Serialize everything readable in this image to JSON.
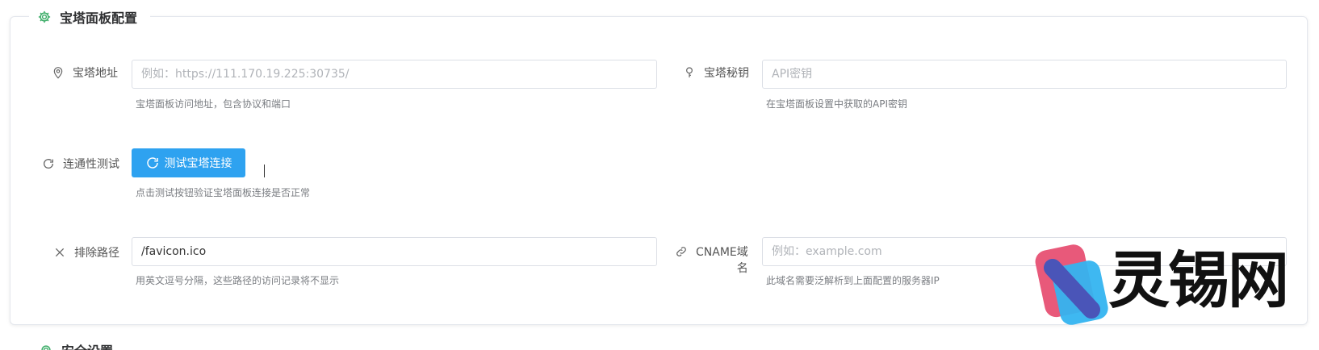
{
  "section": {
    "title": "宝塔面板配置",
    "icon": "gear-icon"
  },
  "fields": {
    "bt_address": {
      "label": "宝塔地址",
      "icon": "location-pin-icon",
      "value": "",
      "placeholder": "例如：https://111.170.19.225:30735/",
      "help": "宝塔面板访问地址，包含协议和端口"
    },
    "bt_key": {
      "label": "宝塔秘钥",
      "icon": "key-bulb-icon",
      "value": "",
      "placeholder": "API密钥",
      "help": "在宝塔面板设置中获取的API密钥"
    },
    "connectivity": {
      "label": "连通性测试",
      "icon": "refresh-icon",
      "button_label": "测试宝塔连接",
      "help": "点击测试按钮验证宝塔面板连接是否正常"
    },
    "exclude_path": {
      "label": "排除路径",
      "icon": "close-icon",
      "value": "/favicon.ico",
      "placeholder": "",
      "help": "用英文逗号分隔，这些路径的访问记录将不显示"
    },
    "cname": {
      "label_line1": "CNAME域",
      "label_line2": "名",
      "icon": "link-icon",
      "value": "",
      "placeholder": "例如：example.com",
      "help": "此域名需要泛解析到上面配置的服务器IP"
    }
  },
  "next_section": {
    "title": "安全设置",
    "icon": "gear-icon"
  },
  "watermark": {
    "text": "灵锡网"
  },
  "colors": {
    "primary": "#2ea2f0",
    "accent_green": "#3fae6a"
  }
}
